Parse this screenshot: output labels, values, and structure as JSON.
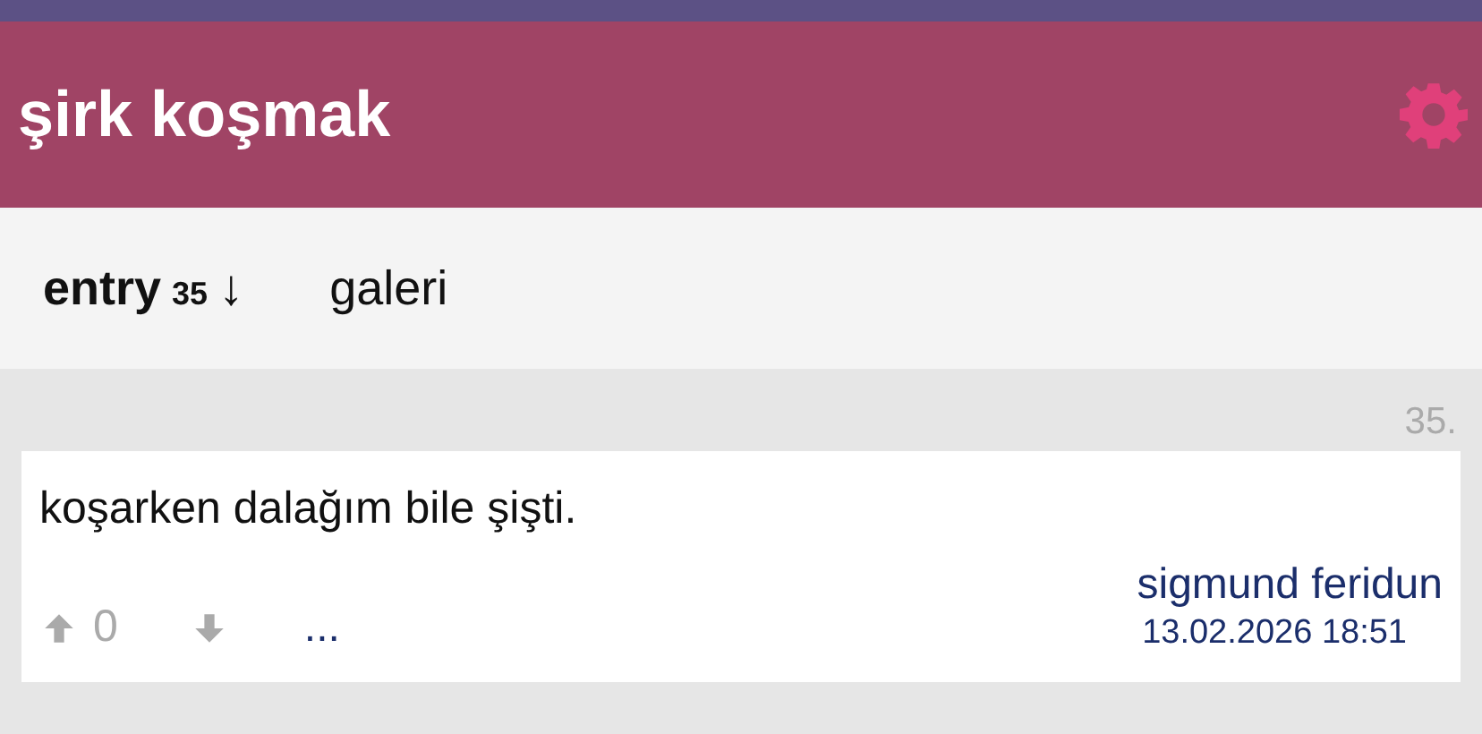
{
  "header": {
    "title": "şirk koşmak"
  },
  "tabs": [
    {
      "label": "entry",
      "count": "35",
      "sort": "↓",
      "selected": true
    },
    {
      "label": "galeri",
      "selected": false
    }
  ],
  "entries": [
    {
      "number": "35.",
      "text": "koşarken dalağım bile şişti.",
      "votes": "0",
      "more": "...",
      "author": "sigmund feridun",
      "date": "13.02.2026 18:51"
    }
  ]
}
